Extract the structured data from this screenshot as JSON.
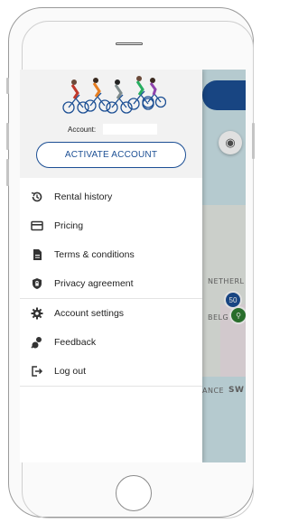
{
  "drawer": {
    "account_label": "Account:",
    "account_value": "",
    "activate_button": "ACTIVATE ACCOUNT",
    "menu_group_1": [
      {
        "label": "Rental history",
        "icon": "history-icon"
      },
      {
        "label": "Pricing",
        "icon": "credit-card-icon"
      },
      {
        "label": "Terms & conditions",
        "icon": "document-icon"
      },
      {
        "label": "Privacy agreement",
        "icon": "shield-lock-icon"
      }
    ],
    "menu_group_2": [
      {
        "label": "Account settings",
        "icon": "gear-icon"
      },
      {
        "label": "Feedback",
        "icon": "feedback-icon"
      },
      {
        "label": "Log out",
        "icon": "logout-icon"
      }
    ]
  },
  "map": {
    "labels": [
      "NETHERL",
      "BELG",
      "ANCE",
      "SW"
    ],
    "pin_text": "50"
  },
  "colors": {
    "brand": "#1c4f94",
    "water": "#cfe6ec",
    "land": "#e7ece6",
    "header_bg": "#f2f2f2"
  }
}
